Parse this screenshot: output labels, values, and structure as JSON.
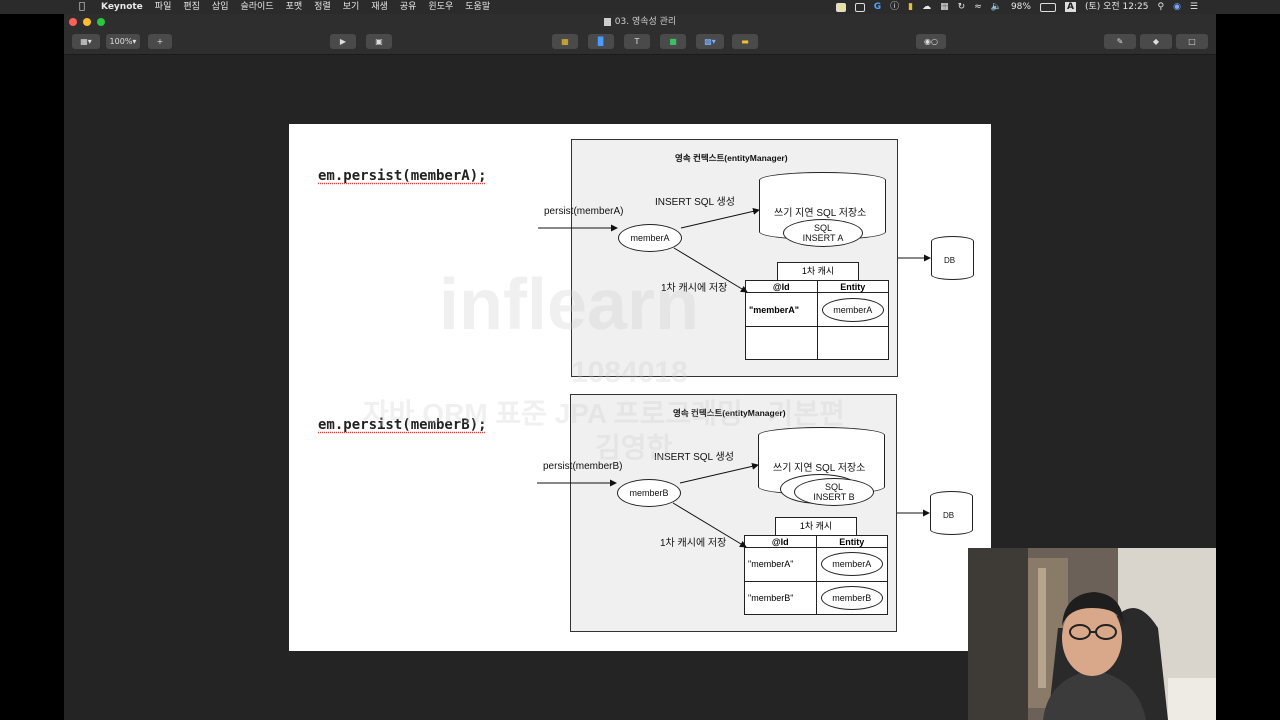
{
  "menubar": {
    "app_name": "Keynote",
    "menus": [
      "파일",
      "편집",
      "삽입",
      "슬라이드",
      "포맷",
      "정렬",
      "보기",
      "재생",
      "공유",
      "윈도우",
      "도움말"
    ],
    "battery": "98%",
    "input_source": "A",
    "clock": "(토) 오전 12:25"
  },
  "window": {
    "title": "03. 영속성 관리",
    "zoom": "100%"
  },
  "slide": {
    "diagrams": [
      {
        "code": "em.persist(memberA);",
        "context_title": "영속 컨텍스트(entityManager)",
        "persist_label": "persist(memberA)",
        "insert_label": "INSERT SQL 생성",
        "store_title": "쓰기 지연 SQL 저장소",
        "sql_items": [
          {
            "line1": "SQL",
            "line2": "INSERT A"
          }
        ],
        "entity_label": "memberA",
        "cache_save_label": "1차 캐시에 저장",
        "cache_title": "1차 캐시",
        "cache_headers": [
          "@Id",
          "Entity"
        ],
        "cache_rows": [
          {
            "id": "\"memberA\"",
            "entity": "memberA"
          }
        ],
        "db_label": "DB"
      },
      {
        "code": "em.persist(memberB);",
        "context_title": "영속 컨텍스트(entityManager)",
        "persist_label": "persist(memberB)",
        "insert_label": "INSERT SQL 생성",
        "store_title": "쓰기 지연 SQL 저장소",
        "sql_items": [
          {
            "line1": "SQL",
            "line2": "INSERT B"
          }
        ],
        "entity_label": "memberB",
        "cache_save_label": "1차 캐시에 저장",
        "cache_title": "1차 캐시",
        "cache_headers": [
          "@Id",
          "Entity"
        ],
        "cache_rows": [
          {
            "id": "\"memberA\"",
            "entity": "memberA"
          },
          {
            "id": "\"memberB\"",
            "entity": "memberB"
          }
        ],
        "db_label": "DB"
      }
    ]
  },
  "watermark": {
    "brand": "inflearn",
    "id": "1084018",
    "course": "자바 ORM 표준 JPA 프로그래밍 - 기본편",
    "author": "김영한"
  }
}
